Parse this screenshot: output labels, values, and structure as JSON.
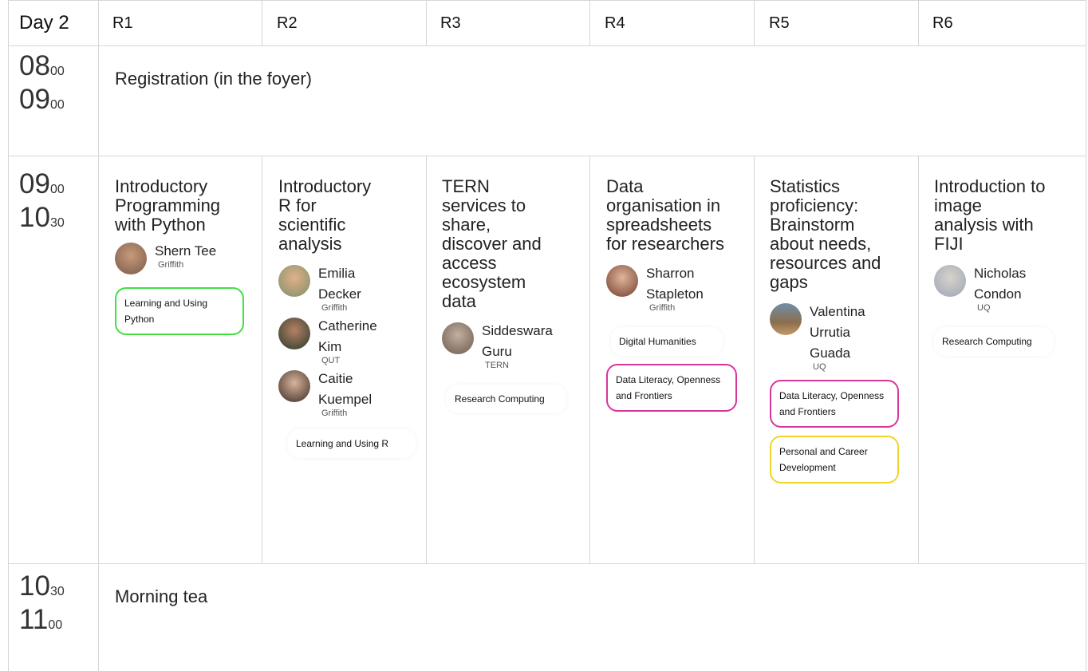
{
  "header": {
    "day": "Day 2",
    "rooms": [
      "R1",
      "R2",
      "R3",
      "R4",
      "R5",
      "R6"
    ]
  },
  "colors": {
    "green": "#3fe03f",
    "pink": "#d6369c",
    "yellow": "#f1d32a",
    "grid": "#d6d6d6"
  },
  "slots": [
    {
      "start_h": "08",
      "start_m": "00",
      "end_h": "09",
      "end_m": "00",
      "label": "Registration (in the foyer)"
    },
    {
      "start_h": "09",
      "start_m": "00",
      "end_h": "10",
      "end_m": "30"
    },
    {
      "start_h": "10",
      "start_m": "30",
      "end_h": "11",
      "end_m": "00",
      "label": "Morning tea"
    }
  ],
  "sessions": [
    {
      "title": "Introductory Programming with Python",
      "speakers": [
        {
          "name": "Shern Tee",
          "org": "Griffith"
        }
      ],
      "tags": [
        {
          "label": "Learning and Using Python",
          "style": "green"
        }
      ]
    },
    {
      "title": "Introductory R for scientific analysis",
      "speakers": [
        {
          "name": "Emilia Decker",
          "org": "Griffith"
        },
        {
          "name": "Catherine Kim",
          "org": "QUT"
        },
        {
          "name": "Caitie Kuempel",
          "org": "Griffith"
        }
      ],
      "tags": [
        {
          "label": "Learning and Using R",
          "style": "plain"
        }
      ]
    },
    {
      "title": "TERN services to share, discover and access ecosystem data",
      "speakers": [
        {
          "name": "Siddeswara Guru",
          "org": "TERN"
        }
      ],
      "tags": [
        {
          "label": "Research Computing",
          "style": "plain"
        }
      ]
    },
    {
      "title": "Data organisation in spreadsheets for researchers",
      "speakers": [
        {
          "name": "Sharron Stapleton",
          "org": "Griffith"
        }
      ],
      "tags": [
        {
          "label": "Digital Humanities",
          "style": "plain"
        },
        {
          "label": "Data Literacy, Openness and Frontiers",
          "style": "pink"
        }
      ]
    },
    {
      "title": "Statistics proficiency: Brainstorm about needs, resources and gaps",
      "speakers": [
        {
          "name": "Valentina Urrutia Guada",
          "org": "UQ"
        }
      ],
      "tags": [
        {
          "label": "Data Literacy, Openness and Frontiers",
          "style": "pink"
        },
        {
          "label": "Personal and Career Development",
          "style": "yellow"
        }
      ]
    },
    {
      "title": "Introduction to image analysis with FIJI",
      "speakers": [
        {
          "name": "Nicholas Condon",
          "org": "UQ"
        }
      ],
      "tags": [
        {
          "label": "Research Computing",
          "style": "plain"
        }
      ]
    }
  ]
}
